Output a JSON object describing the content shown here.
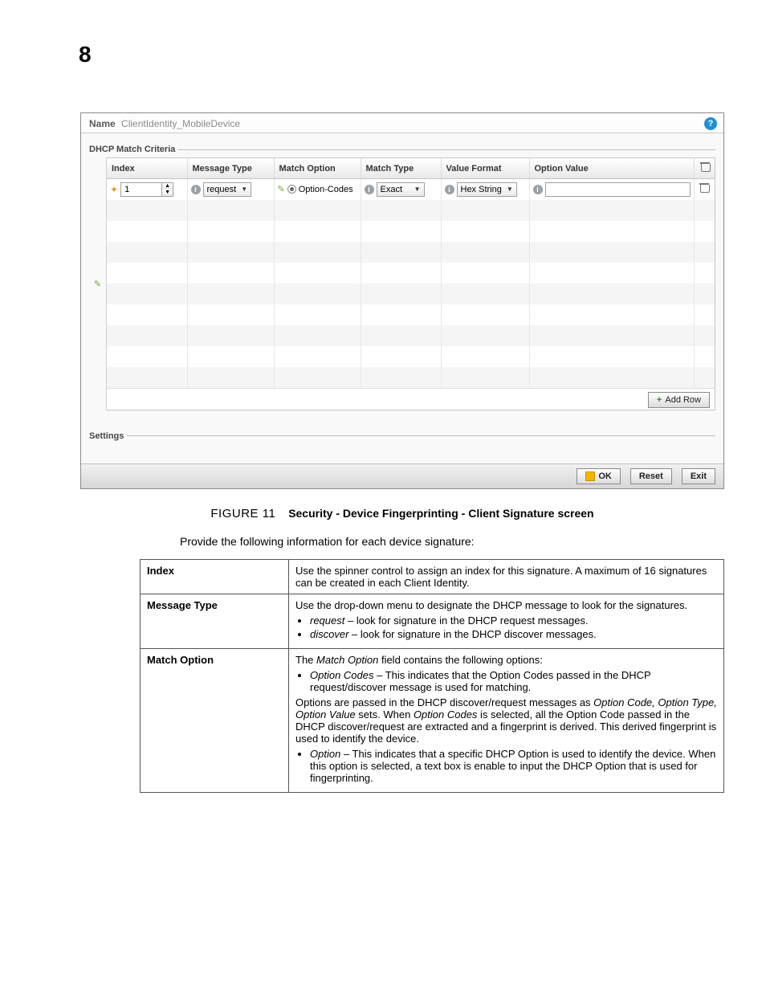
{
  "page_number": "8",
  "panel": {
    "name_label": "Name",
    "name_value": "ClientIdentity_MobileDevice",
    "section1": "DHCP Match Criteria",
    "columns": [
      "Index",
      "Message Type",
      "Match Option",
      "Match Type",
      "Value Format",
      "Option Value"
    ],
    "row1": {
      "index": "1",
      "message_type": "request",
      "match_option_label": "Option-Codes",
      "match_type": "Exact",
      "value_format": "Hex String",
      "option_value": ""
    },
    "add_row": "Add Row",
    "section2": "Settings",
    "ok": "OK",
    "reset": "Reset",
    "exit": "Exit"
  },
  "caption": {
    "figure_label": "FIGURE 11",
    "title": "Security - Device Fingerprinting - Client Signature screen"
  },
  "intro": "Provide the following information for each device signature:",
  "desc_rows": [
    {
      "term": "Index",
      "html": "Use the spinner control to assign an index for this signature. A maximum of 16 signatures can be created in each Client Identity."
    },
    {
      "term": "Message Type",
      "html": "Use the drop-down menu to designate the DHCP message to look for the signatures.<ul><li><span class='ital'>request</span> – look for signature in the DHCP request messages.</li><li><span class='ital'>discover</span> – look for signature in the DHCP discover messages.</li></ul>"
    },
    {
      "term": "Match Option",
      "html": "The <span class='ital'>Match Option</span> field contains the following options:<ul><li><span class='ital'>Option Codes</span> – This indicates that the Option Codes passed in the DHCP request/discover message is used for matching.</li></ul>Options are passed in the DHCP discover/request messages as <span class='ital'>Option Code, Option Type, Option Value</span> sets. When <span class='ital'>Option Codes</span> is selected, all the Option Code passed in the DHCP discover/request are extracted and a fingerprint is derived. This derived fingerprint is used to identify the device.<ul><li><span class='ital'>Option</span> – This indicates that a specific DHCP Option is used to identify the device. When this option is selected, a text box is enable to input the DHCP Option that is used for fingerprinting.</li></ul>"
    }
  ]
}
